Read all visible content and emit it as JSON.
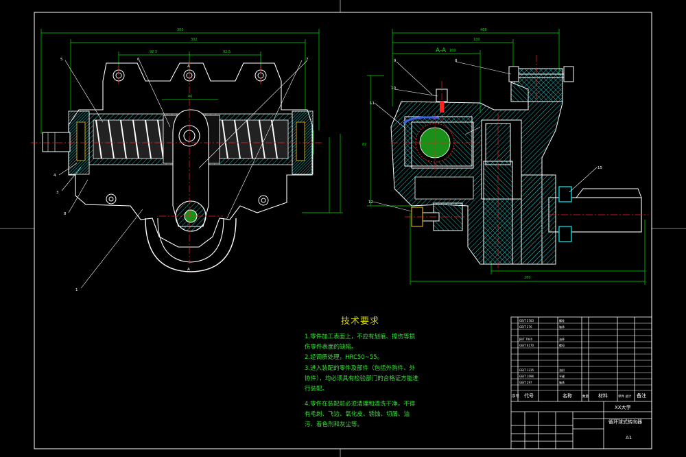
{
  "section_label": "A-A",
  "tech_requirements": {
    "title": "技术要求",
    "items": [
      "1.零件加工表面上，不应有划痕、擦伤等损伤零件表面的缺陷。",
      "2.经调质处理，HRC50~55。",
      "3.进入装配的零件及部件（包括外购件、外协件），均必须具有检验部门的合格证方能进行装配。",
      "4.零件在装配前必须清理和清洗干净，不得有毛刺、飞边、氧化皮、锈蚀、切屑、油污、着色剂和灰尘等。"
    ]
  },
  "title_block": {
    "school": "XX大学",
    "drawing_name": "循环球式转向器",
    "sheet_size": "A1",
    "col_no": "序号",
    "col_code": "代号",
    "col_name": "名称",
    "col_qty": "数量",
    "col_material": "材料",
    "col_weight": "单件 总计",
    "col_remark": "备注"
  },
  "colors": {
    "background": "#000000",
    "frame": "#ffffff",
    "dimension": "#00e000",
    "centerline": "#ff2020",
    "hatch": "#20c0c0",
    "outline": "#ffffff",
    "part_blue": "#3a5fe0"
  }
}
